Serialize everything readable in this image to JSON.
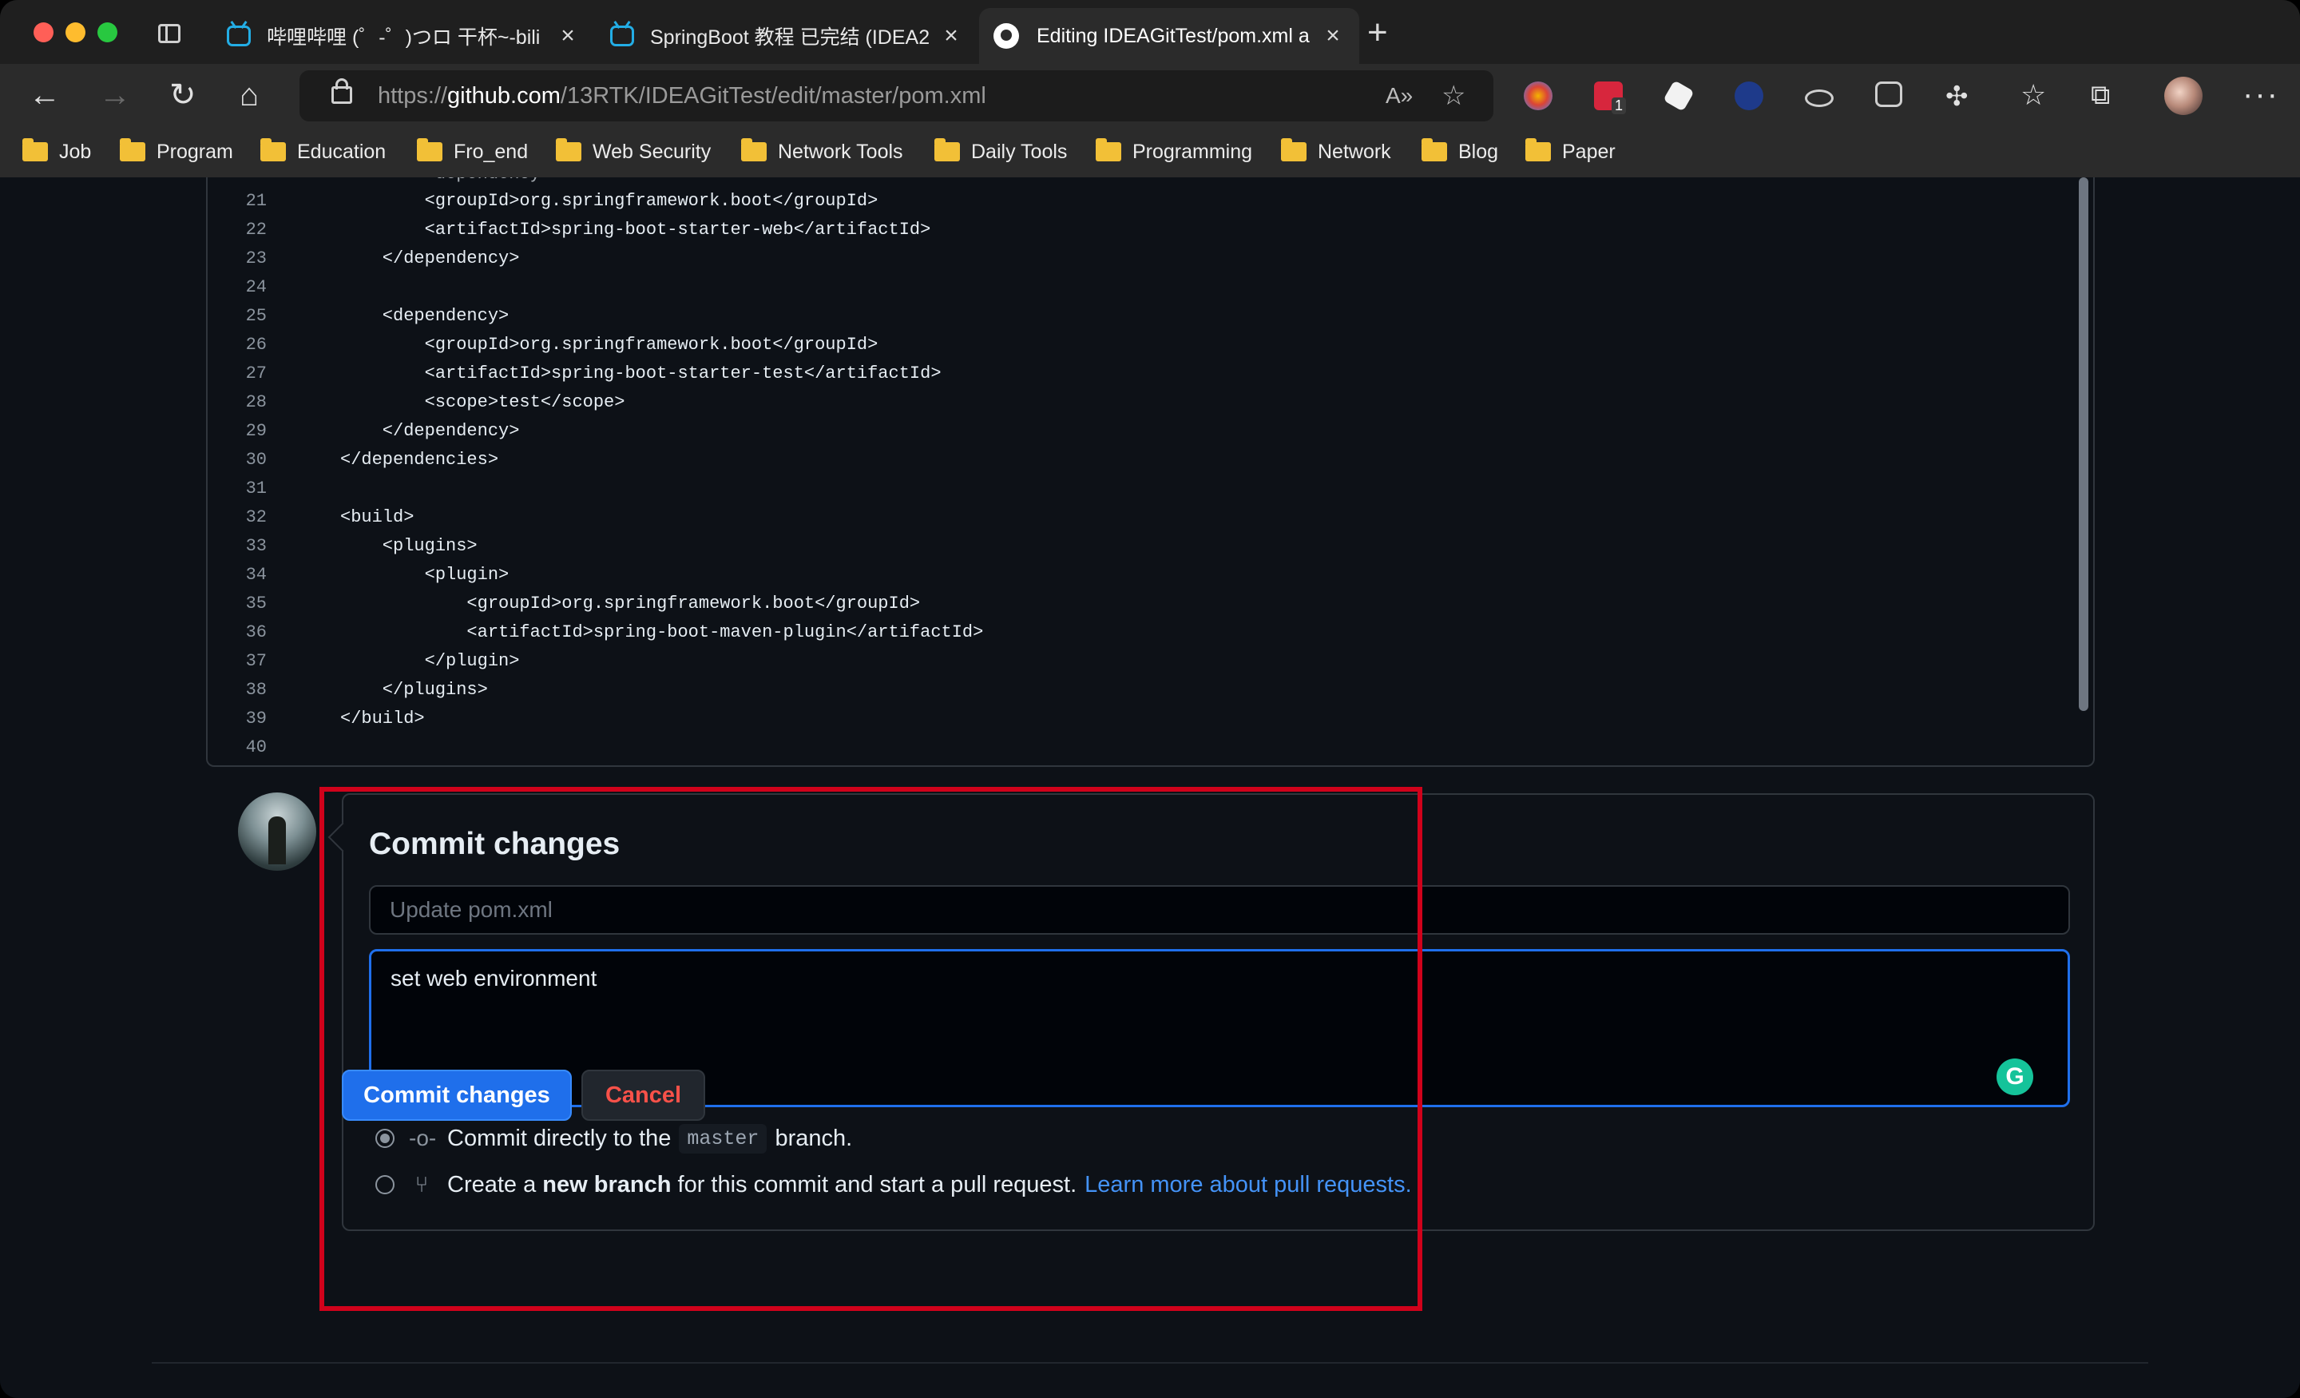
{
  "browser": {
    "tabs": [
      {
        "title": "哔哩哔哩 (゜-゜)つロ 干杯~-bili",
        "icon": "bilibili-icon",
        "active": false
      },
      {
        "title": "SpringBoot 教程 已完结 (IDEA2",
        "icon": "bilibili-icon",
        "active": false
      },
      {
        "title": "Editing IDEAGitTest/pom.xml a",
        "icon": "github-icon",
        "active": true
      }
    ],
    "url_prefix": "https://",
    "url_host": "github.com",
    "url_path": "/13RTK/IDEAGitTest/edit/master/pom.xml",
    "extension_badge": "1",
    "bookmarks": [
      "Job",
      "Program",
      "Education",
      "Fro_end",
      "Web Security",
      "Network Tools",
      "Daily Tools",
      "Programming",
      "Network",
      "Blog",
      "Paper"
    ]
  },
  "editor": {
    "top_partial_line": "        <dependency>",
    "lines": [
      {
        "n": "21",
        "code": "        <groupId>org.springframework.boot</groupId>"
      },
      {
        "n": "22",
        "code": "        <artifactId>spring-boot-starter-web</artifactId>"
      },
      {
        "n": "23",
        "code": "    </dependency>"
      },
      {
        "n": "24",
        "code": ""
      },
      {
        "n": "25",
        "code": "    <dependency>"
      },
      {
        "n": "26",
        "code": "        <groupId>org.springframework.boot</groupId>"
      },
      {
        "n": "27",
        "code": "        <artifactId>spring-boot-starter-test</artifactId>"
      },
      {
        "n": "28",
        "code": "        <scope>test</scope>"
      },
      {
        "n": "29",
        "code": "    </dependency>"
      },
      {
        "n": "30",
        "code": "</dependencies>"
      },
      {
        "n": "31",
        "code": ""
      },
      {
        "n": "32",
        "code": "<build>"
      },
      {
        "n": "33",
        "code": "    <plugins>"
      },
      {
        "n": "34",
        "code": "        <plugin>"
      },
      {
        "n": "35",
        "code": "            <groupId>org.springframework.boot</groupId>"
      },
      {
        "n": "36",
        "code": "            <artifactId>spring-boot-maven-plugin</artifactId>"
      },
      {
        "n": "37",
        "code": "        </plugin>"
      },
      {
        "n": "38",
        "code": "    </plugins>"
      },
      {
        "n": "39",
        "code": "</build>"
      },
      {
        "n": "40",
        "code": ""
      }
    ]
  },
  "commit": {
    "title": "Commit changes",
    "summary_placeholder": "Update pom.xml",
    "summary_value": "",
    "description_value": "set web environment",
    "option_direct_prefix": "Commit directly to the",
    "option_direct_branch": "master",
    "option_direct_suffix": "branch.",
    "option_direct_checked": true,
    "option_new_prefix": "Create a",
    "option_new_bold": "new branch",
    "option_new_suffix": "for this commit and start a pull request.",
    "option_new_link": "Learn more about pull requests.",
    "option_new_checked": false,
    "commit_button": "Commit changes",
    "cancel_button": "Cancel"
  },
  "colors": {
    "accent_blue": "#1f6feb",
    "link_blue": "#4493f8",
    "cancel_red": "#f85149",
    "highlight_red": "#d0021b",
    "grammarly_green": "#15c39a"
  }
}
